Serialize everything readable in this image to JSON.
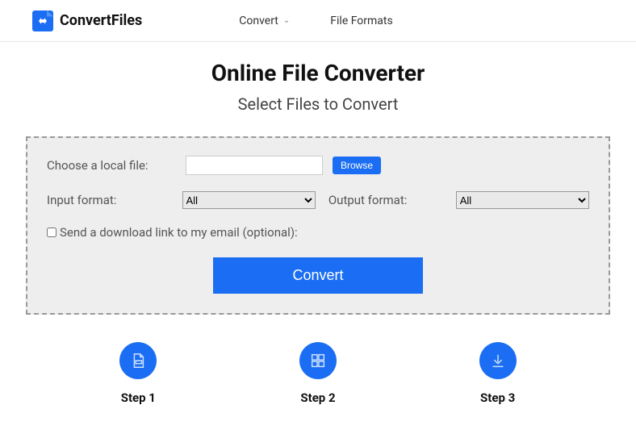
{
  "brand": "ConvertFiles",
  "nav": {
    "convert": "Convert",
    "formats": "File Formats"
  },
  "hero": {
    "title": "Online File Converter",
    "subtitle": "Select Files to Convert"
  },
  "form": {
    "local_file_label": "Choose a local file:",
    "browse": "Browse",
    "input_format_label": "Input format:",
    "input_format_value": "All",
    "output_format_label": "Output format:",
    "output_format_value": "All",
    "email_checkbox": "Send a download link to my email (optional):",
    "convert": "Convert"
  },
  "steps": {
    "s1": "Step 1",
    "s2": "Step 2",
    "s3": "Step 3"
  },
  "colors": {
    "accent": "#1b6ef3"
  }
}
